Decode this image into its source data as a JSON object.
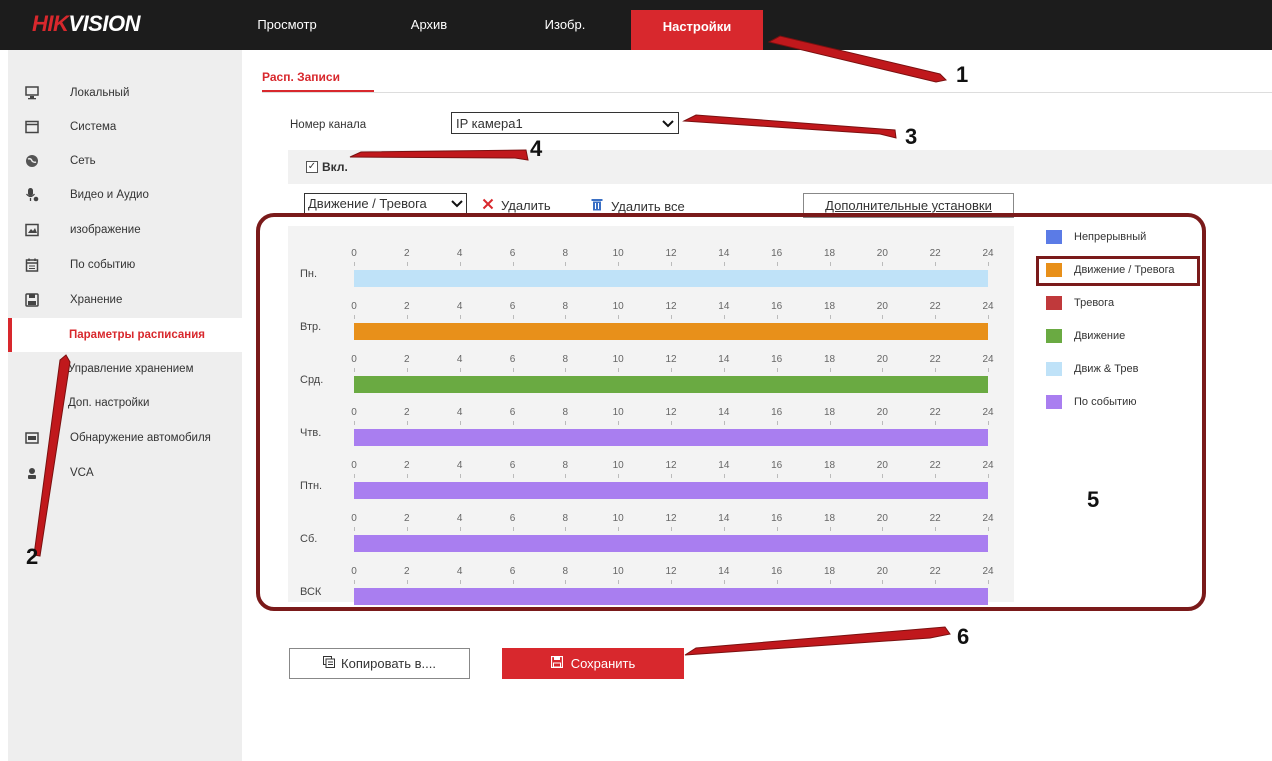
{
  "logo": {
    "part1": "HIK",
    "part2": "VISION"
  },
  "nav": {
    "tabs": [
      {
        "label": "Просмотр"
      },
      {
        "label": "Архив"
      },
      {
        "label": "Изобр."
      },
      {
        "label": "Настройки"
      }
    ],
    "active": "Настройки"
  },
  "sidebar": {
    "items": [
      {
        "label": "Локальный",
        "icon": "monitor-icon"
      },
      {
        "label": "Система",
        "icon": "window-icon"
      },
      {
        "label": "Сеть",
        "icon": "globe-icon"
      },
      {
        "label": "Видео и Аудио",
        "icon": "mic-icon"
      },
      {
        "label": "изображение",
        "icon": "image-icon"
      },
      {
        "label": "По событию",
        "icon": "calendar-icon"
      },
      {
        "label": "Хранение",
        "icon": "save-icon"
      },
      {
        "label": "Параметры расписания",
        "sub": true,
        "active": true
      },
      {
        "label": "Управление хранением",
        "sub": true
      },
      {
        "label": "Доп. настройки",
        "sub": true
      },
      {
        "label": "Обнаружение автомобиля",
        "icon": "car-icon"
      },
      {
        "label": "VCA",
        "icon": "vca-icon"
      }
    ]
  },
  "main": {
    "subtab": "Расп. Записи",
    "channel_label": "Номер канала",
    "channel_value": "IP камера1",
    "enable_label": "Вкл.",
    "enable_checked": true,
    "type_value": "Движение / Тревога",
    "delete_label": "Удалить",
    "delete_all_label": "Удалить все",
    "advanced_label": "Дополнительные установки",
    "copy_label": "Копировать в....",
    "save_label": "Сохранить"
  },
  "schedule": {
    "ticks": [
      "0",
      "2",
      "4",
      "6",
      "8",
      "10",
      "12",
      "14",
      "16",
      "18",
      "20",
      "22",
      "24"
    ],
    "days": [
      {
        "label": "Пн.",
        "color": "#bfe2f8"
      },
      {
        "label": "Втр.",
        "color": "#e8901a"
      },
      {
        "label": "Срд.",
        "color": "#6aaa42"
      },
      {
        "label": "Чтв.",
        "color": "#a97ef0"
      },
      {
        "label": "Птн.",
        "color": "#a97ef0"
      },
      {
        "label": "Сб.",
        "color": "#a97ef0"
      },
      {
        "label": "ВСК",
        "color": "#a97ef0"
      }
    ]
  },
  "legend": [
    {
      "label": "Непрерывный",
      "color": "#5b7be6"
    },
    {
      "label": "Движение / Тревога",
      "color": "#e8901a"
    },
    {
      "label": "Тревога",
      "color": "#c0393b"
    },
    {
      "label": "Движение",
      "color": "#6aaa42"
    },
    {
      "label": "Движ & Трев",
      "color": "#bfe2f8"
    },
    {
      "label": "По событию",
      "color": "#a97ef0"
    }
  ],
  "annotations": [
    "1",
    "2",
    "3",
    "4",
    "5",
    "6"
  ],
  "colors": {
    "accent": "#d8282d",
    "annotation": "#7a1a1a",
    "arrow": "#c0181c"
  }
}
